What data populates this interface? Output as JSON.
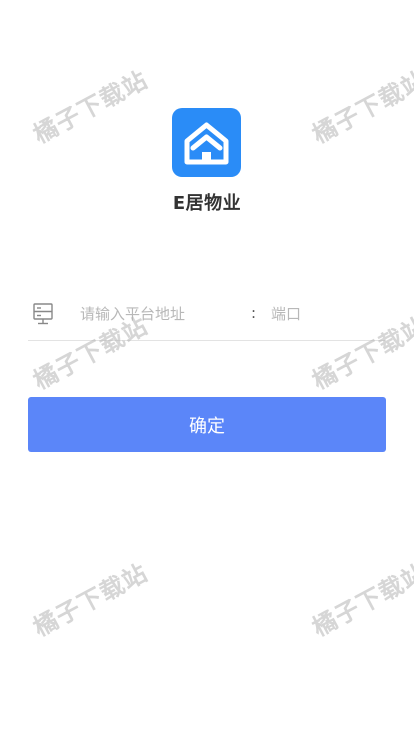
{
  "app": {
    "name": "E居物业",
    "logo_icon": "house-icon",
    "brand_color": "#2a8cf7"
  },
  "server": {
    "icon": "server-icon",
    "address_placeholder": "请输入平台地址",
    "separator": ":",
    "port_placeholder": "端口"
  },
  "actions": {
    "confirm_label": "确定",
    "confirm_color": "#5b86f9"
  },
  "watermark": {
    "text": "橘子下载站"
  }
}
